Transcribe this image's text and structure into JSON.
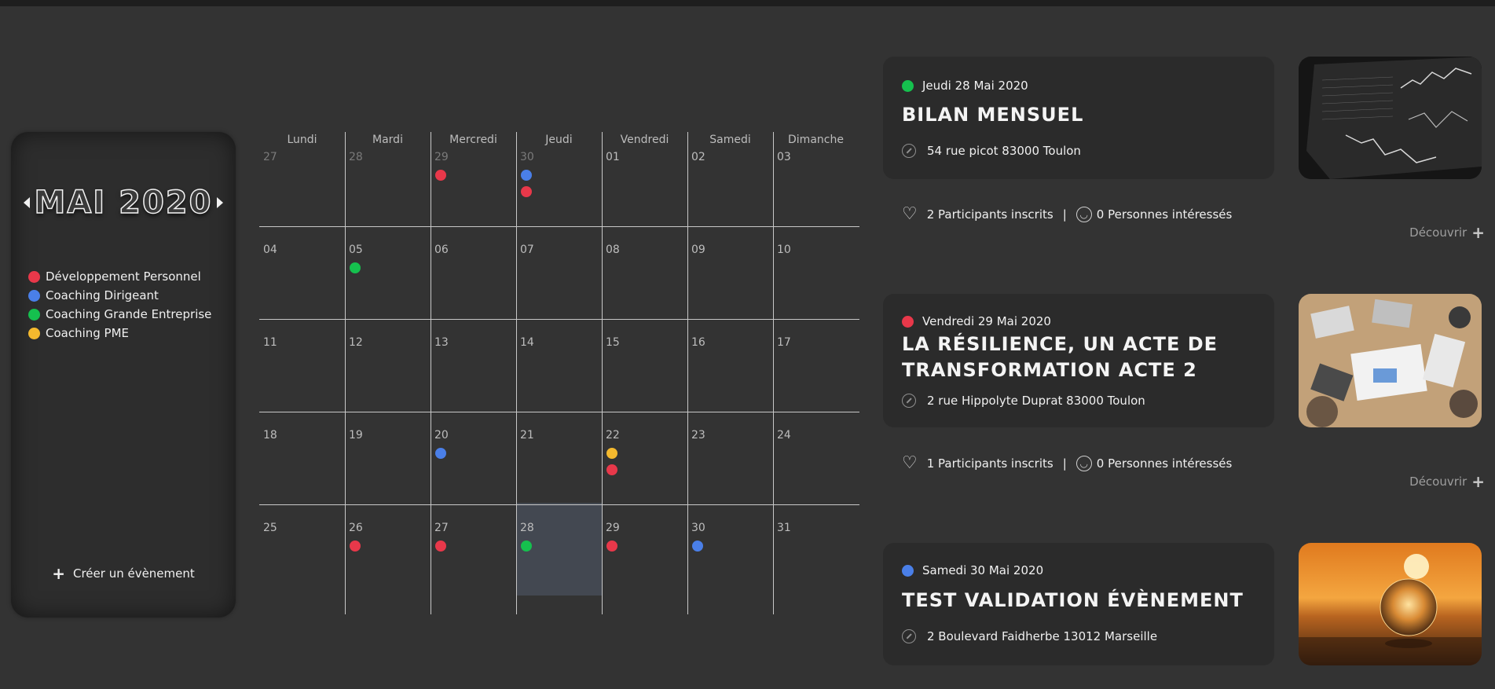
{
  "sidebar": {
    "month_title": "MAI 2020",
    "legend": [
      {
        "label": "Développement Personnel",
        "color": "#e8384a"
      },
      {
        "label": "Coaching Dirigeant",
        "color": "#4a7fe8"
      },
      {
        "label": "Coaching Grande Entreprise",
        "color": "#15c04e"
      },
      {
        "label": "Coaching PME",
        "color": "#f4b92e"
      }
    ],
    "create_label": "Créer un évènement"
  },
  "calendar": {
    "days": [
      "Lundi",
      "Mardi",
      "Mercredi",
      "Jeudi",
      "Vendredi",
      "Samedi",
      "Dimanche"
    ],
    "colors": {
      "red": "#e8384a",
      "blue": "#4a7fe8",
      "green": "#15c04e",
      "yellow": "#f4b92e"
    },
    "weeks": [
      [
        {
          "n": "27",
          "other": true,
          "dots": []
        },
        {
          "n": "28",
          "other": true,
          "dots": []
        },
        {
          "n": "29",
          "other": true,
          "dots": [
            "red"
          ]
        },
        {
          "n": "30",
          "other": true,
          "dots": [
            "blue",
            "red"
          ]
        },
        {
          "n": "01",
          "dots": []
        },
        {
          "n": "02",
          "dots": []
        },
        {
          "n": "03",
          "dots": []
        }
      ],
      [
        {
          "n": "04",
          "dots": []
        },
        {
          "n": "05",
          "dots": [
            "green"
          ]
        },
        {
          "n": "06",
          "dots": []
        },
        {
          "n": "07",
          "dots": []
        },
        {
          "n": "08",
          "dots": []
        },
        {
          "n": "09",
          "dots": []
        },
        {
          "n": "10",
          "dots": []
        }
      ],
      [
        {
          "n": "11",
          "dots": []
        },
        {
          "n": "12",
          "dots": []
        },
        {
          "n": "13",
          "dots": []
        },
        {
          "n": "14",
          "dots": []
        },
        {
          "n": "15",
          "dots": []
        },
        {
          "n": "16",
          "dots": []
        },
        {
          "n": "17",
          "dots": []
        }
      ],
      [
        {
          "n": "18",
          "dots": []
        },
        {
          "n": "19",
          "dots": []
        },
        {
          "n": "20",
          "dots": [
            "blue"
          ]
        },
        {
          "n": "21",
          "dots": []
        },
        {
          "n": "22",
          "dots": [
            "yellow",
            "red"
          ]
        },
        {
          "n": "23",
          "dots": []
        },
        {
          "n": "24",
          "dots": []
        }
      ],
      [
        {
          "n": "25",
          "dots": []
        },
        {
          "n": "26",
          "dots": [
            "red"
          ]
        },
        {
          "n": "27",
          "dots": [
            "red"
          ]
        },
        {
          "n": "28",
          "today": true,
          "dots": [
            "green"
          ]
        },
        {
          "n": "29",
          "dots": [
            "red"
          ]
        },
        {
          "n": "30",
          "dots": [
            "blue"
          ]
        },
        {
          "n": "31",
          "dots": []
        }
      ]
    ]
  },
  "events": [
    {
      "date": "Jeudi 28 Mai 2020",
      "color": "#15c04e",
      "title": "BILAN MENSUEL",
      "address": "54 rue picot 83000 Toulon",
      "participants": "2 Participants inscrits",
      "separator": "|",
      "interested": "0 Personnes intéressés",
      "discover": "Découvrir",
      "thumb_icon": "stock-chart-photo"
    },
    {
      "date": "Vendredi 29 Mai 2020",
      "color": "#e8384a",
      "title": "LA RÉSILIENCE, UN ACTE DE TRANSFORMATION ACTE 2",
      "address": "2 rue Hippolyte Duprat 83000 Toulon",
      "participants": "1 Participants inscrits",
      "separator": "|",
      "interested": "0 Personnes intéressés",
      "discover": "Découvrir",
      "thumb_icon": "meeting-table-photo"
    },
    {
      "date": "Samedi 30 Mai 2020",
      "color": "#4a7fe8",
      "title": "TEST VALIDATION ÉVÈNEMENT",
      "address": "2 Boulevard Faidherbe 13012 Marseille",
      "thumb_icon": "sunset-crystal-ball-photo"
    }
  ]
}
